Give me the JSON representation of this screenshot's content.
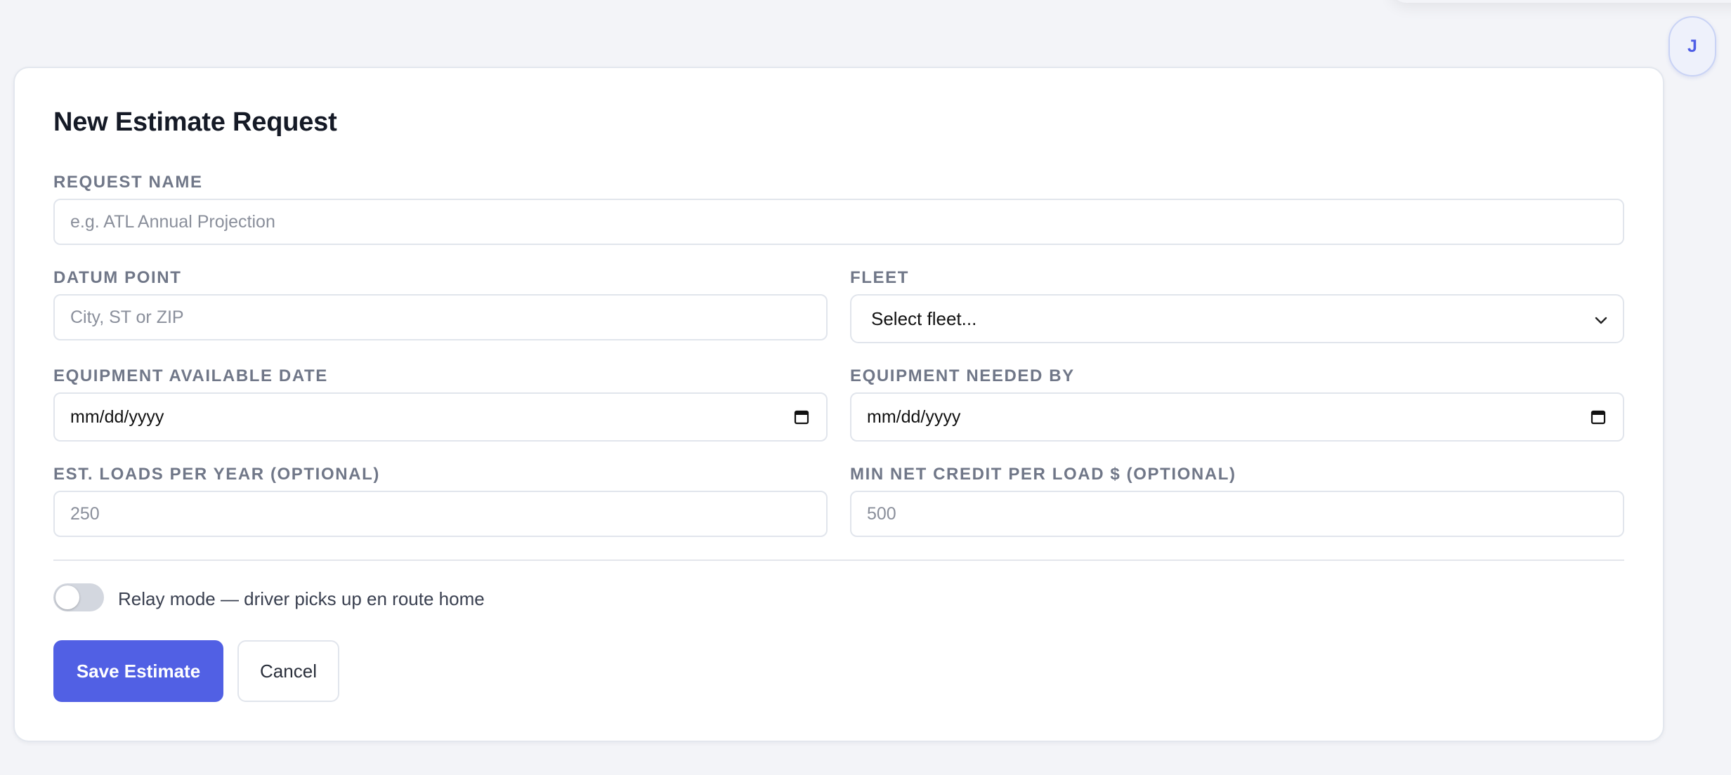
{
  "user": {
    "avatar_initial": "J"
  },
  "form": {
    "title": "New Estimate Request",
    "request_name": {
      "label": "REQUEST NAME",
      "placeholder": "e.g. ATL Annual Projection"
    },
    "datum_point": {
      "label": "DATUM POINT",
      "placeholder": "City, ST or ZIP"
    },
    "fleet": {
      "label": "FLEET",
      "selected": "Select fleet..."
    },
    "equipment_available_date": {
      "label": "EQUIPMENT AVAILABLE DATE",
      "value": "mm/dd/yyyy"
    },
    "equipment_needed_by": {
      "label": "EQUIPMENT NEEDED BY",
      "value": "mm/dd/yyyy"
    },
    "est_loads_per_year": {
      "label": "EST. LOADS PER YEAR (OPTIONAL)",
      "placeholder": "250"
    },
    "min_net_credit": {
      "label": "MIN NET CREDIT PER LOAD $ (OPTIONAL)",
      "placeholder": "500"
    },
    "relay_mode": {
      "label": "Relay mode — driver picks up en route home",
      "enabled": false
    },
    "save_label": "Save Estimate",
    "cancel_label": "Cancel"
  },
  "colors": {
    "accent": "#5160e4",
    "background": "#f3f4f8"
  },
  "icons": {
    "calendar": "calendar-icon",
    "chevron": "chevron-down-icon"
  }
}
